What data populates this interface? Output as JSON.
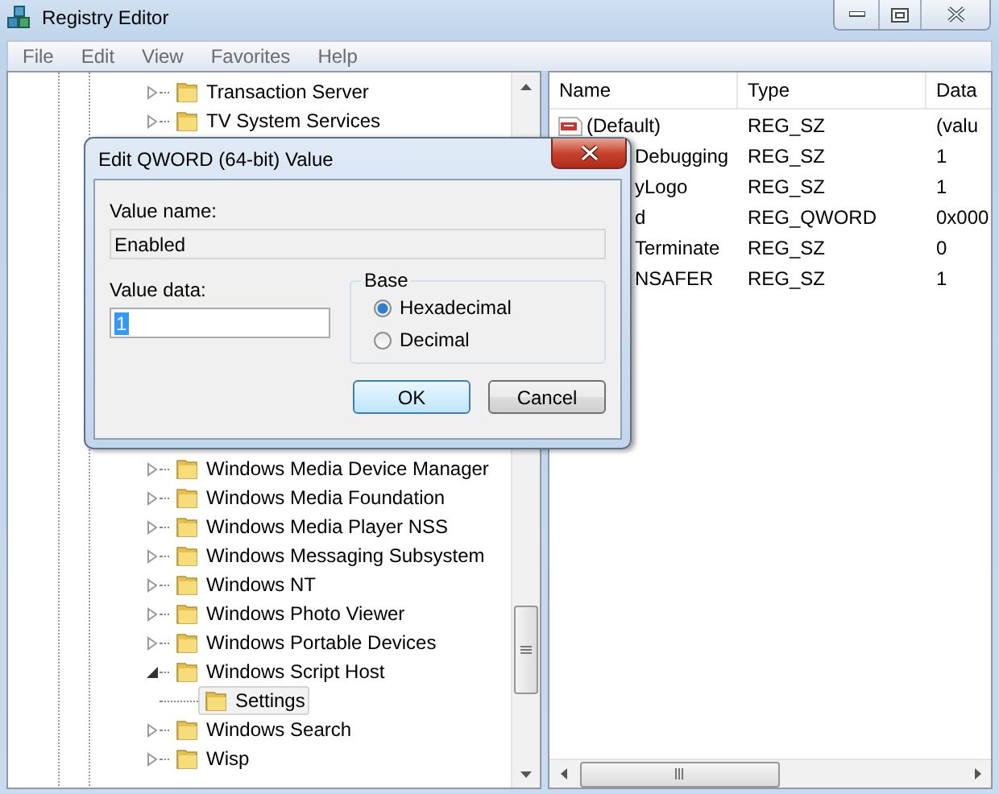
{
  "window": {
    "title": "Registry Editor"
  },
  "menu": [
    "File",
    "Edit",
    "View",
    "Favorites",
    "Help"
  ],
  "tree": {
    "top": [
      {
        "label": "Transaction Server",
        "expanded": false
      },
      {
        "label": "TV System Services",
        "expanded": false
      }
    ],
    "bottom": [
      {
        "label": "Windows Media Device Manager",
        "expanded": false
      },
      {
        "label": "Windows Media Foundation",
        "expanded": false
      },
      {
        "label": "Windows Media Player NSS",
        "expanded": false
      },
      {
        "label": "Windows Messaging Subsystem",
        "expanded": false
      },
      {
        "label": "Windows NT",
        "expanded": false
      },
      {
        "label": "Windows Photo Viewer",
        "expanded": false
      },
      {
        "label": "Windows Portable Devices",
        "expanded": false
      },
      {
        "label": "Windows Script Host",
        "expanded": true,
        "children": [
          {
            "label": "Settings",
            "selected": true
          }
        ]
      },
      {
        "label": "Windows Search",
        "expanded": false
      },
      {
        "label": "Wisp",
        "expanded": false
      }
    ]
  },
  "values": {
    "columns": [
      "Name",
      "Type",
      "Data"
    ],
    "rows": [
      {
        "name": "(Default)",
        "kind": "icon",
        "type": "REG_SZ",
        "data": "(valu"
      },
      {
        "name": "Debugging",
        "kind": "covered",
        "type": "REG_SZ",
        "data": "1"
      },
      {
        "name": "yLogo",
        "kind": "covered",
        "type": "REG_SZ",
        "data": "1"
      },
      {
        "name": "d",
        "kind": "covered",
        "type": "REG_QWORD",
        "data": "0x000"
      },
      {
        "name": "Terminate",
        "kind": "covered",
        "type": "REG_SZ",
        "data": "0"
      },
      {
        "name": "NSAFER",
        "kind": "covered",
        "type": "REG_SZ",
        "data": "1"
      }
    ]
  },
  "dialog": {
    "title": "Edit QWORD (64-bit) Value",
    "value_name": {
      "label": "Value name:",
      "value": "Enabled",
      "readonly": true
    },
    "value_data": {
      "label": "Value data:",
      "value": "1",
      "highlighted": true
    },
    "base": {
      "label": "Base",
      "options": [
        {
          "label": "Hexadecimal",
          "selected": true
        },
        {
          "label": "Decimal",
          "selected": false
        }
      ]
    },
    "buttons": [
      {
        "label": "OK",
        "default": true
      },
      {
        "label": "Cancel",
        "default": false
      }
    ]
  }
}
